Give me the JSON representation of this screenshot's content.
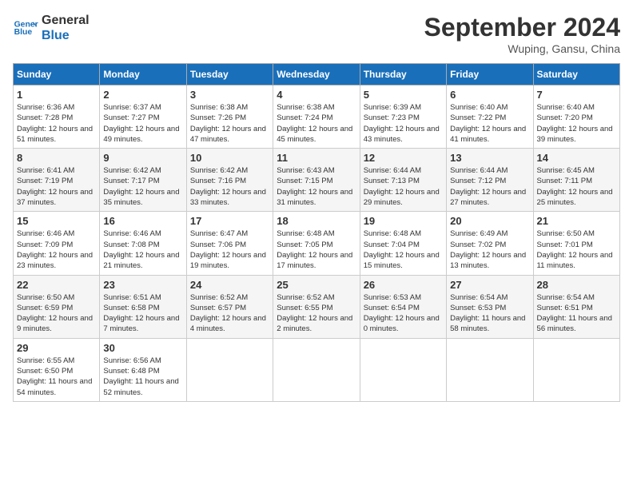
{
  "header": {
    "logo_line1": "General",
    "logo_line2": "Blue",
    "month_title": "September 2024",
    "location": "Wuping, Gansu, China"
  },
  "days_of_week": [
    "Sunday",
    "Monday",
    "Tuesday",
    "Wednesday",
    "Thursday",
    "Friday",
    "Saturday"
  ],
  "weeks": [
    [
      {
        "day": 1,
        "sunrise": "6:36 AM",
        "sunset": "7:28 PM",
        "daylight": "12 hours and 51 minutes."
      },
      {
        "day": 2,
        "sunrise": "6:37 AM",
        "sunset": "7:27 PM",
        "daylight": "12 hours and 49 minutes."
      },
      {
        "day": 3,
        "sunrise": "6:38 AM",
        "sunset": "7:26 PM",
        "daylight": "12 hours and 47 minutes."
      },
      {
        "day": 4,
        "sunrise": "6:38 AM",
        "sunset": "7:24 PM",
        "daylight": "12 hours and 45 minutes."
      },
      {
        "day": 5,
        "sunrise": "6:39 AM",
        "sunset": "7:23 PM",
        "daylight": "12 hours and 43 minutes."
      },
      {
        "day": 6,
        "sunrise": "6:40 AM",
        "sunset": "7:22 PM",
        "daylight": "12 hours and 41 minutes."
      },
      {
        "day": 7,
        "sunrise": "6:40 AM",
        "sunset": "7:20 PM",
        "daylight": "12 hours and 39 minutes."
      }
    ],
    [
      {
        "day": 8,
        "sunrise": "6:41 AM",
        "sunset": "7:19 PM",
        "daylight": "12 hours and 37 minutes."
      },
      {
        "day": 9,
        "sunrise": "6:42 AM",
        "sunset": "7:17 PM",
        "daylight": "12 hours and 35 minutes."
      },
      {
        "day": 10,
        "sunrise": "6:42 AM",
        "sunset": "7:16 PM",
        "daylight": "12 hours and 33 minutes."
      },
      {
        "day": 11,
        "sunrise": "6:43 AM",
        "sunset": "7:15 PM",
        "daylight": "12 hours and 31 minutes."
      },
      {
        "day": 12,
        "sunrise": "6:44 AM",
        "sunset": "7:13 PM",
        "daylight": "12 hours and 29 minutes."
      },
      {
        "day": 13,
        "sunrise": "6:44 AM",
        "sunset": "7:12 PM",
        "daylight": "12 hours and 27 minutes."
      },
      {
        "day": 14,
        "sunrise": "6:45 AM",
        "sunset": "7:11 PM",
        "daylight": "12 hours and 25 minutes."
      }
    ],
    [
      {
        "day": 15,
        "sunrise": "6:46 AM",
        "sunset": "7:09 PM",
        "daylight": "12 hours and 23 minutes."
      },
      {
        "day": 16,
        "sunrise": "6:46 AM",
        "sunset": "7:08 PM",
        "daylight": "12 hours and 21 minutes."
      },
      {
        "day": 17,
        "sunrise": "6:47 AM",
        "sunset": "7:06 PM",
        "daylight": "12 hours and 19 minutes."
      },
      {
        "day": 18,
        "sunrise": "6:48 AM",
        "sunset": "7:05 PM",
        "daylight": "12 hours and 17 minutes."
      },
      {
        "day": 19,
        "sunrise": "6:48 AM",
        "sunset": "7:04 PM",
        "daylight": "12 hours and 15 minutes."
      },
      {
        "day": 20,
        "sunrise": "6:49 AM",
        "sunset": "7:02 PM",
        "daylight": "12 hours and 13 minutes."
      },
      {
        "day": 21,
        "sunrise": "6:50 AM",
        "sunset": "7:01 PM",
        "daylight": "12 hours and 11 minutes."
      }
    ],
    [
      {
        "day": 22,
        "sunrise": "6:50 AM",
        "sunset": "6:59 PM",
        "daylight": "12 hours and 9 minutes."
      },
      {
        "day": 23,
        "sunrise": "6:51 AM",
        "sunset": "6:58 PM",
        "daylight": "12 hours and 7 minutes."
      },
      {
        "day": 24,
        "sunrise": "6:52 AM",
        "sunset": "6:57 PM",
        "daylight": "12 hours and 4 minutes."
      },
      {
        "day": 25,
        "sunrise": "6:52 AM",
        "sunset": "6:55 PM",
        "daylight": "12 hours and 2 minutes."
      },
      {
        "day": 26,
        "sunrise": "6:53 AM",
        "sunset": "6:54 PM",
        "daylight": "12 hours and 0 minutes."
      },
      {
        "day": 27,
        "sunrise": "6:54 AM",
        "sunset": "6:53 PM",
        "daylight": "11 hours and 58 minutes."
      },
      {
        "day": 28,
        "sunrise": "6:54 AM",
        "sunset": "6:51 PM",
        "daylight": "11 hours and 56 minutes."
      }
    ],
    [
      {
        "day": 29,
        "sunrise": "6:55 AM",
        "sunset": "6:50 PM",
        "daylight": "11 hours and 54 minutes."
      },
      {
        "day": 30,
        "sunrise": "6:56 AM",
        "sunset": "6:48 PM",
        "daylight": "11 hours and 52 minutes."
      },
      null,
      null,
      null,
      null,
      null
    ]
  ]
}
